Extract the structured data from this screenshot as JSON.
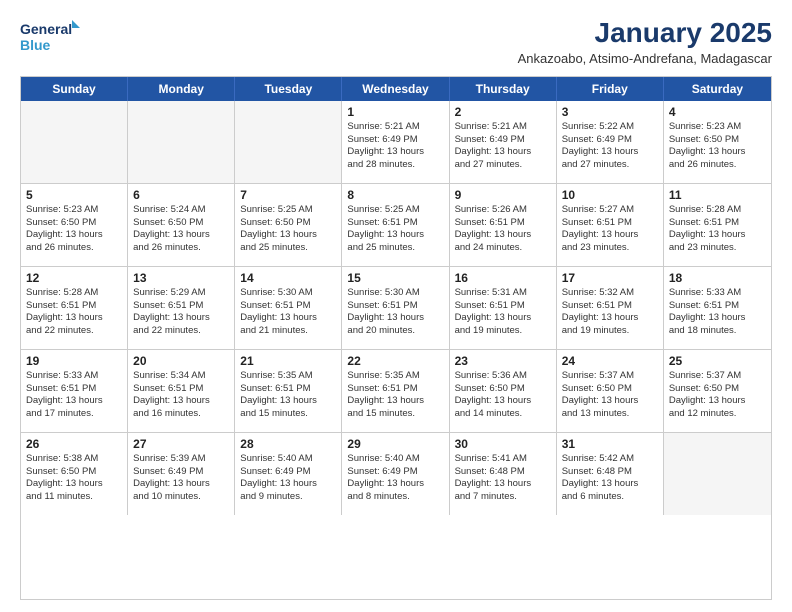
{
  "header": {
    "logo_line1": "General",
    "logo_line2": "Blue",
    "month_title": "January 2025",
    "location": "Ankazoabo, Atsimo-Andrefana, Madagascar"
  },
  "weekdays": [
    "Sunday",
    "Monday",
    "Tuesday",
    "Wednesday",
    "Thursday",
    "Friday",
    "Saturday"
  ],
  "weeks": [
    [
      {
        "day": "",
        "info": ""
      },
      {
        "day": "",
        "info": ""
      },
      {
        "day": "",
        "info": ""
      },
      {
        "day": "1",
        "info": "Sunrise: 5:21 AM\nSunset: 6:49 PM\nDaylight: 13 hours\nand 28 minutes."
      },
      {
        "day": "2",
        "info": "Sunrise: 5:21 AM\nSunset: 6:49 PM\nDaylight: 13 hours\nand 27 minutes."
      },
      {
        "day": "3",
        "info": "Sunrise: 5:22 AM\nSunset: 6:49 PM\nDaylight: 13 hours\nand 27 minutes."
      },
      {
        "day": "4",
        "info": "Sunrise: 5:23 AM\nSunset: 6:50 PM\nDaylight: 13 hours\nand 26 minutes."
      }
    ],
    [
      {
        "day": "5",
        "info": "Sunrise: 5:23 AM\nSunset: 6:50 PM\nDaylight: 13 hours\nand 26 minutes."
      },
      {
        "day": "6",
        "info": "Sunrise: 5:24 AM\nSunset: 6:50 PM\nDaylight: 13 hours\nand 26 minutes."
      },
      {
        "day": "7",
        "info": "Sunrise: 5:25 AM\nSunset: 6:50 PM\nDaylight: 13 hours\nand 25 minutes."
      },
      {
        "day": "8",
        "info": "Sunrise: 5:25 AM\nSunset: 6:51 PM\nDaylight: 13 hours\nand 25 minutes."
      },
      {
        "day": "9",
        "info": "Sunrise: 5:26 AM\nSunset: 6:51 PM\nDaylight: 13 hours\nand 24 minutes."
      },
      {
        "day": "10",
        "info": "Sunrise: 5:27 AM\nSunset: 6:51 PM\nDaylight: 13 hours\nand 23 minutes."
      },
      {
        "day": "11",
        "info": "Sunrise: 5:28 AM\nSunset: 6:51 PM\nDaylight: 13 hours\nand 23 minutes."
      }
    ],
    [
      {
        "day": "12",
        "info": "Sunrise: 5:28 AM\nSunset: 6:51 PM\nDaylight: 13 hours\nand 22 minutes."
      },
      {
        "day": "13",
        "info": "Sunrise: 5:29 AM\nSunset: 6:51 PM\nDaylight: 13 hours\nand 22 minutes."
      },
      {
        "day": "14",
        "info": "Sunrise: 5:30 AM\nSunset: 6:51 PM\nDaylight: 13 hours\nand 21 minutes."
      },
      {
        "day": "15",
        "info": "Sunrise: 5:30 AM\nSunset: 6:51 PM\nDaylight: 13 hours\nand 20 minutes."
      },
      {
        "day": "16",
        "info": "Sunrise: 5:31 AM\nSunset: 6:51 PM\nDaylight: 13 hours\nand 19 minutes."
      },
      {
        "day": "17",
        "info": "Sunrise: 5:32 AM\nSunset: 6:51 PM\nDaylight: 13 hours\nand 19 minutes."
      },
      {
        "day": "18",
        "info": "Sunrise: 5:33 AM\nSunset: 6:51 PM\nDaylight: 13 hours\nand 18 minutes."
      }
    ],
    [
      {
        "day": "19",
        "info": "Sunrise: 5:33 AM\nSunset: 6:51 PM\nDaylight: 13 hours\nand 17 minutes."
      },
      {
        "day": "20",
        "info": "Sunrise: 5:34 AM\nSunset: 6:51 PM\nDaylight: 13 hours\nand 16 minutes."
      },
      {
        "day": "21",
        "info": "Sunrise: 5:35 AM\nSunset: 6:51 PM\nDaylight: 13 hours\nand 15 minutes."
      },
      {
        "day": "22",
        "info": "Sunrise: 5:35 AM\nSunset: 6:51 PM\nDaylight: 13 hours\nand 15 minutes."
      },
      {
        "day": "23",
        "info": "Sunrise: 5:36 AM\nSunset: 6:50 PM\nDaylight: 13 hours\nand 14 minutes."
      },
      {
        "day": "24",
        "info": "Sunrise: 5:37 AM\nSunset: 6:50 PM\nDaylight: 13 hours\nand 13 minutes."
      },
      {
        "day": "25",
        "info": "Sunrise: 5:37 AM\nSunset: 6:50 PM\nDaylight: 13 hours\nand 12 minutes."
      }
    ],
    [
      {
        "day": "26",
        "info": "Sunrise: 5:38 AM\nSunset: 6:50 PM\nDaylight: 13 hours\nand 11 minutes."
      },
      {
        "day": "27",
        "info": "Sunrise: 5:39 AM\nSunset: 6:49 PM\nDaylight: 13 hours\nand 10 minutes."
      },
      {
        "day": "28",
        "info": "Sunrise: 5:40 AM\nSunset: 6:49 PM\nDaylight: 13 hours\nand 9 minutes."
      },
      {
        "day": "29",
        "info": "Sunrise: 5:40 AM\nSunset: 6:49 PM\nDaylight: 13 hours\nand 8 minutes."
      },
      {
        "day": "30",
        "info": "Sunrise: 5:41 AM\nSunset: 6:48 PM\nDaylight: 13 hours\nand 7 minutes."
      },
      {
        "day": "31",
        "info": "Sunrise: 5:42 AM\nSunset: 6:48 PM\nDaylight: 13 hours\nand 6 minutes."
      },
      {
        "day": "",
        "info": ""
      }
    ]
  ]
}
